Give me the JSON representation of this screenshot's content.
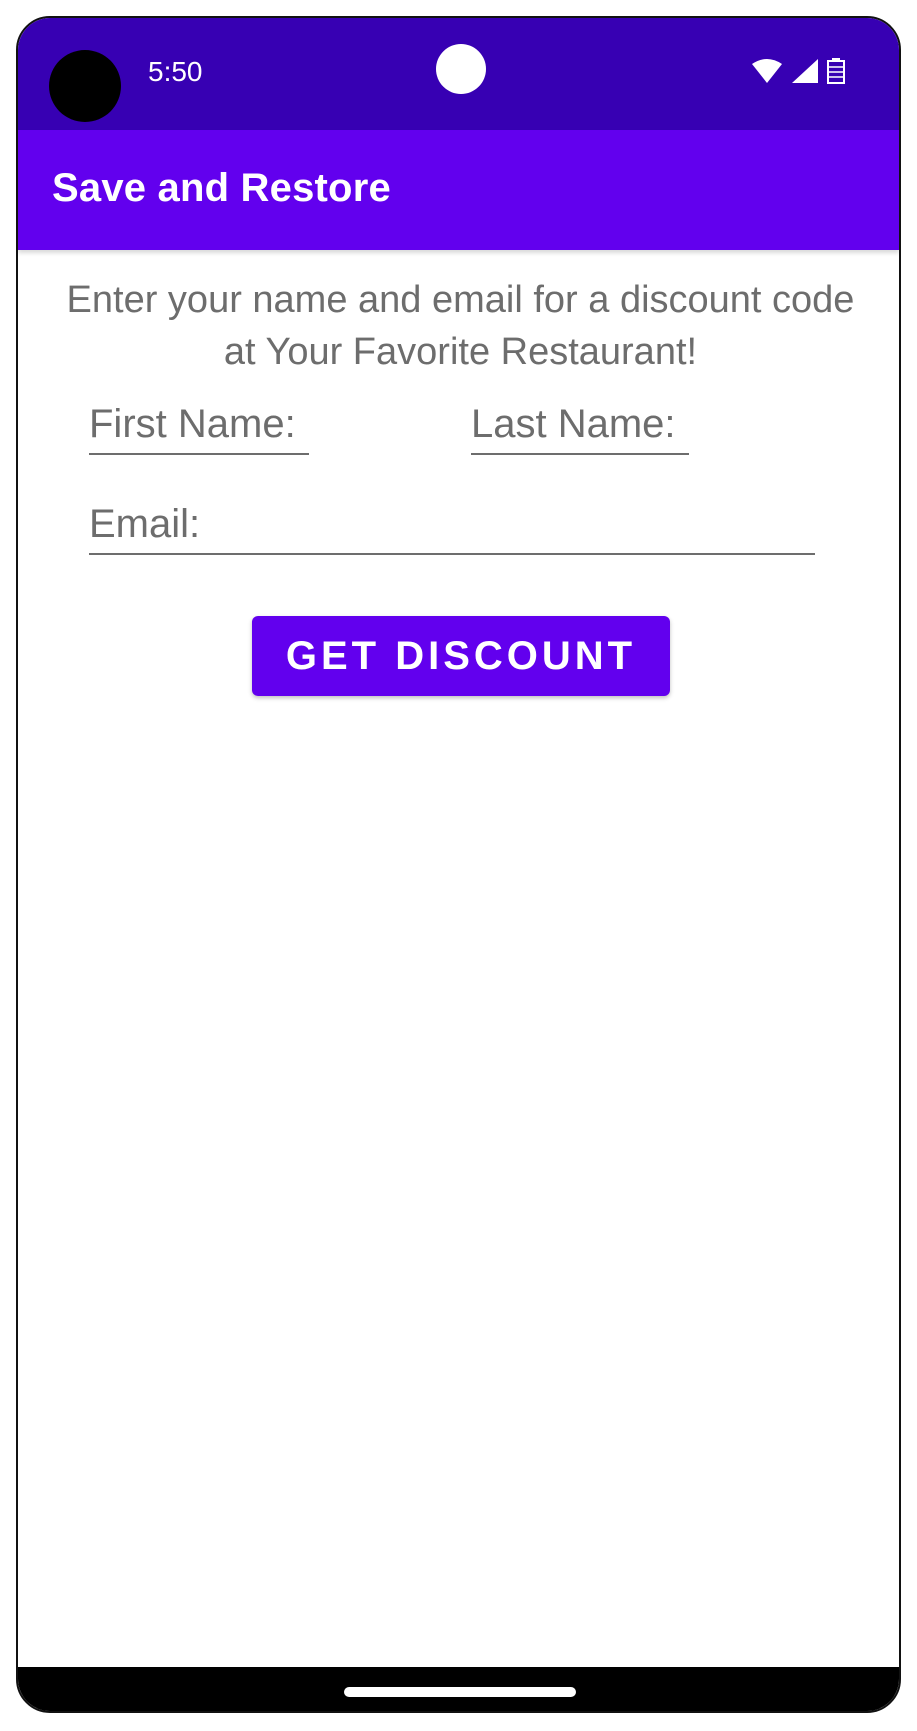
{
  "status_bar": {
    "time": "5:50",
    "icons": [
      "wifi-icon",
      "signal-icon",
      "battery-icon"
    ]
  },
  "app_bar": {
    "title": "Save and Restore"
  },
  "main": {
    "intro_text": "Enter your name and email for a discount code at Your Favorite Restaurant!",
    "first_name_hint": "First Name:",
    "last_name_hint": "Last Name:",
    "email_hint": "Email:",
    "button_label": "GET DISCOUNT"
  },
  "colors": {
    "status_bar": "#3700b3",
    "primary": "#6200ee",
    "hint_text": "#6d6d6d"
  }
}
